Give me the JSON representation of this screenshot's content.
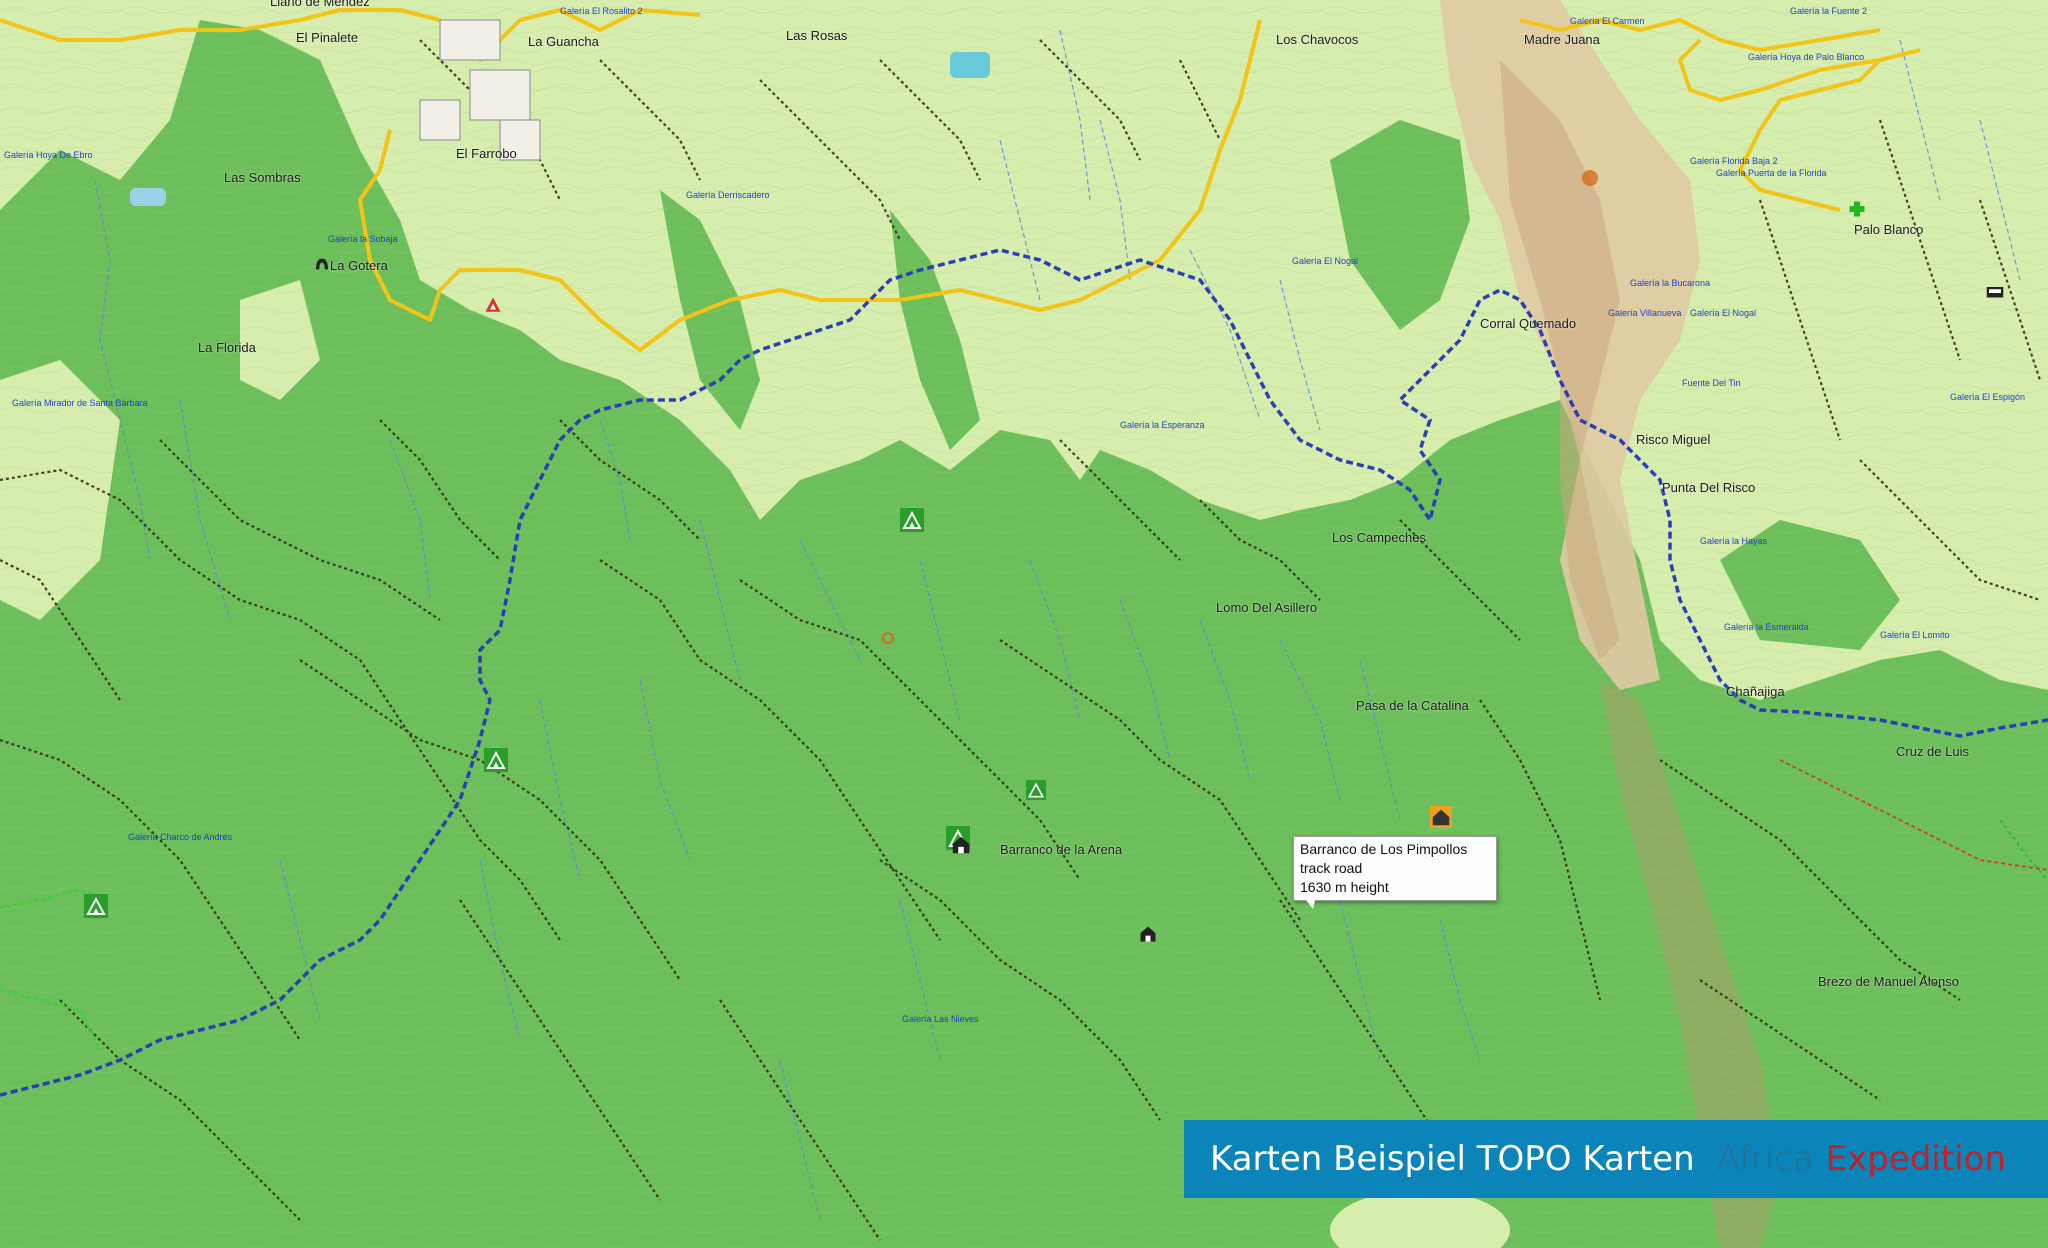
{
  "map": {
    "colors": {
      "forest": "#6cbf5a",
      "open_land": "#d7edae",
      "rock": "#e0c9a3",
      "road": "#f2c418",
      "trail": "#3a2a1a",
      "route": "#2a3fb5",
      "stream": "#5a86e0",
      "banner": "#0b85b9"
    },
    "places": [
      {
        "name": "Llano de Méndez"
      },
      {
        "name": "El Pinalete"
      },
      {
        "name": "La Guancha"
      },
      {
        "name": "Las Rosas"
      },
      {
        "name": "Los Chavocos"
      },
      {
        "name": "Madre Juana"
      },
      {
        "name": "Las Sombras"
      },
      {
        "name": "El Farrobo"
      },
      {
        "name": "La Gotera"
      },
      {
        "name": "La Florida"
      },
      {
        "name": "Palo Blanco"
      },
      {
        "name": "Corral Quemado"
      },
      {
        "name": "Risco Miguel"
      },
      {
        "name": "Punta Del Risco"
      },
      {
        "name": "Los Campeches"
      },
      {
        "name": "Lomo Del Asillero"
      },
      {
        "name": "Pasa de la Catalina"
      },
      {
        "name": "Chañajiga"
      },
      {
        "name": "Cruz de Luis"
      },
      {
        "name": "Barranco de la Arena"
      },
      {
        "name": "Brezo de Manuel Alonso"
      }
    ],
    "galerias": [
      {
        "name": "Galería El Rosalito 2"
      },
      {
        "name": "Galería El Carmen"
      },
      {
        "name": "Galería la Fuente 2"
      },
      {
        "name": "Galería Hoya de Palo Blanco"
      },
      {
        "name": "Galería Hoya De Ebro"
      },
      {
        "name": "Galería Derriscadero"
      },
      {
        "name": "Galería Florida Baja 2"
      },
      {
        "name": "Galería Puerta de la Florida"
      },
      {
        "name": "Galería la Sobaja"
      },
      {
        "name": "Galería El Nogal"
      },
      {
        "name": "Galería la Bucarona"
      },
      {
        "name": "Galería Villanueva"
      },
      {
        "name": "Galería El Nogal"
      },
      {
        "name": "Fuente Del Tin"
      },
      {
        "name": "Galería El Espigón"
      },
      {
        "name": "Galería Mirador de Santa Bárbara"
      },
      {
        "name": "Galería la Esperanza"
      },
      {
        "name": "Galería la Hayas"
      },
      {
        "name": "Galería la Esmeralda"
      },
      {
        "name": "Galería Charco de Andrés"
      },
      {
        "name": "Galería Las Nieves"
      },
      {
        "name": "Galería El Lomito"
      }
    ],
    "tooltip": {
      "line1": "Barranco de Los Pimpollos",
      "line2": "track road",
      "line3": "1630 m height"
    },
    "banner": {
      "title": "Karten Beispiel TOPO Karten",
      "brand_part1": "Africa",
      "brand_part2": "Expedition"
    }
  }
}
